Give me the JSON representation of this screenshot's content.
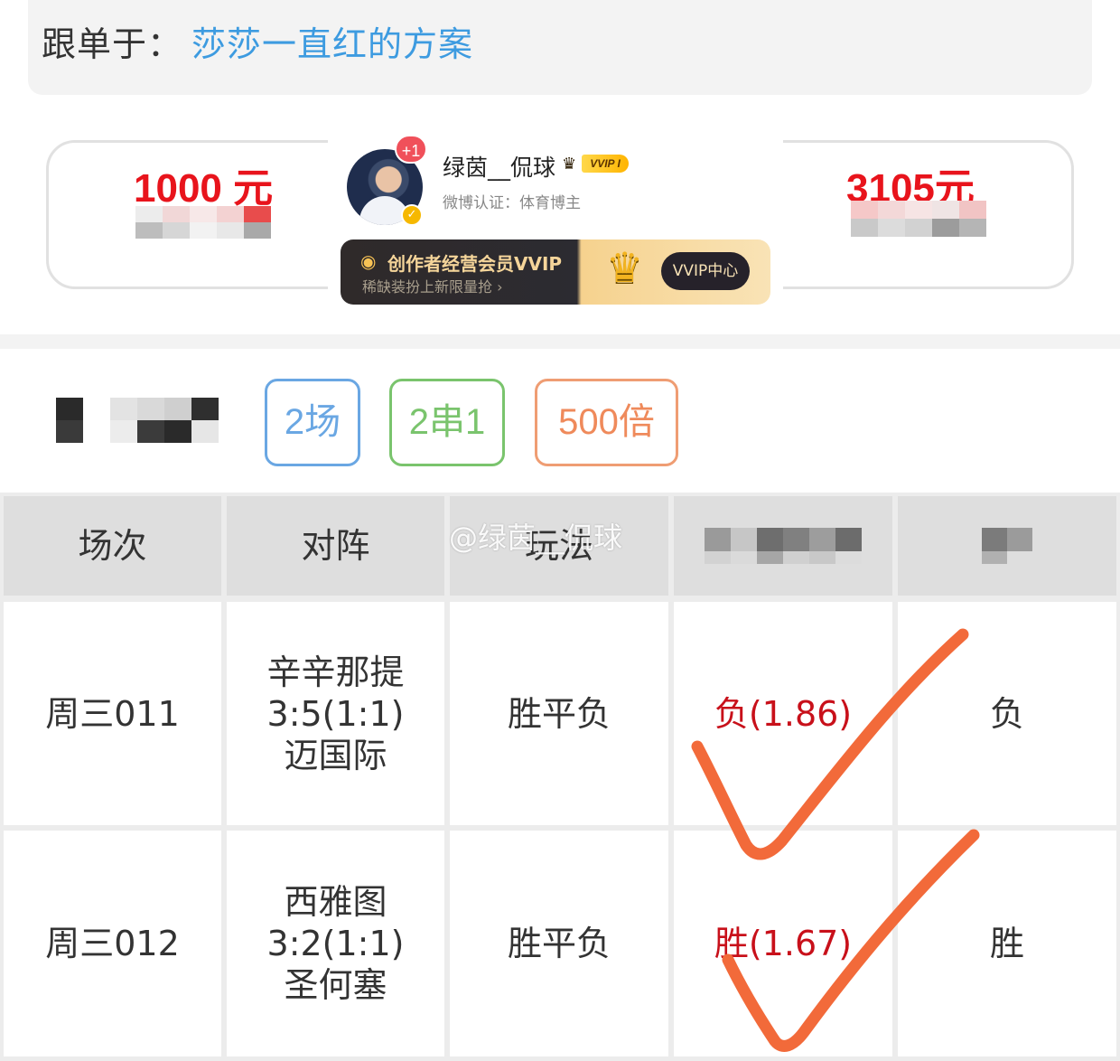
{
  "follow": {
    "label": "跟单于：",
    "plan_name": "莎莎一直红的方案"
  },
  "amounts": {
    "stake": "1000 元",
    "payout": "3105元"
  },
  "profile": {
    "notification_badge": "+1",
    "username": "绿茵__侃球",
    "vip_tag": "VVIP I",
    "certification": "微博认证：体育博主",
    "vvip_banner": {
      "title": "创作者经营会员VVIP",
      "subtitle": "稀缺装扮上新限量抢 ›",
      "button": "VVIP中心"
    }
  },
  "tags": {
    "games": "2场",
    "combo": "2串1",
    "multiplier": "500倍"
  },
  "watermark": "@绿茵__侃球",
  "table": {
    "headers": [
      "场次",
      "对阵",
      "玩法"
    ],
    "rows": [
      {
        "match_no": "周三011",
        "home": "辛辛那提",
        "score": "3:5(1:1)",
        "away": "迈国际",
        "play": "胜平负",
        "pick": "负(1.86)",
        "result": "负"
      },
      {
        "match_no": "周三012",
        "home": "西雅图",
        "score": "3:2(1:1)",
        "away": "圣何塞",
        "play": "胜平负",
        "pick": "胜(1.67)",
        "result": "胜"
      }
    ]
  },
  "colors": {
    "link_blue": "#3d9be0",
    "amount_red": "#e8141c",
    "tag_blue": "#6aa7e3",
    "tag_green": "#7ac46d",
    "tag_orange": "#ef8a5b",
    "check_orange": "#f26a3a"
  }
}
